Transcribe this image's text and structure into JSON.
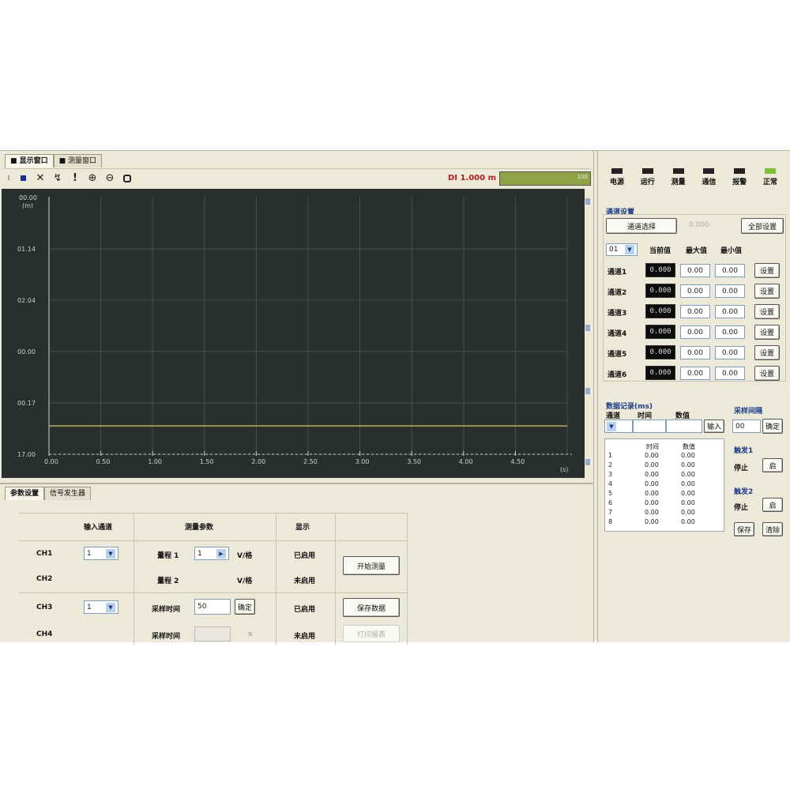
{
  "tabs": [
    "■ 显示窗口",
    "■ 测量窗口"
  ],
  "toolbar": {
    "icons": [
      "stop-square-icon",
      "clear-x-icon",
      "auto-scale-icon",
      "alert-icon",
      "zoom-in-icon",
      "zoom-out-icon",
      "record-icon"
    ],
    "readout": "DI 1.000 m",
    "level_indicator": "100"
  },
  "chart_data": {
    "type": "line",
    "title": "",
    "xlabel": "",
    "ylabel": "(m)",
    "y_top_label": "00.00",
    "y_ticks": [
      "01.14",
      "02.04",
      "00.00",
      "00.17",
      "17.00"
    ],
    "x_ticks": [
      "0.00",
      "0.50",
      "1.00",
      "1.50",
      "2.00",
      "2.50",
      "3.00",
      "3.50",
      "4.00",
      "4.50"
    ],
    "x_end_label": "(s)",
    "series": [
      {
        "values": [
          0.55,
          0.55,
          0.55,
          0.55,
          0.55,
          0.55,
          0.55,
          0.55,
          0.55,
          0.55
        ],
        "color": "#b8b060"
      }
    ],
    "grid": true,
    "background": "#2b2e2e"
  },
  "bottom": {
    "tabs": [
      "参数设置",
      "信号发生器"
    ],
    "col_headers": [
      "输入通道",
      "测量参数",
      "显示"
    ],
    "rows": [
      {
        "label": "CH1",
        "select": "1",
        "param_label": "量程 1",
        "param_value": "1",
        "unit": "V/格",
        "status": "已启用"
      },
      {
        "label": "CH2",
        "param_label": "量程 2",
        "unit": "V/格",
        "status": "未启用"
      },
      {
        "label": "CH3",
        "select": "1",
        "param_label": "采样时间",
        "param_value": "50",
        "apply": "确定",
        "status": "已启用"
      },
      {
        "label": "CH4",
        "param_label": "采样时间",
        "unit": "s",
        "status": "未启用"
      }
    ],
    "buttons": [
      "开始测量",
      "保存数据",
      "打印报表"
    ]
  },
  "right": {
    "leds": [
      {
        "label": "电源",
        "on": false
      },
      {
        "label": "运行",
        "on": false
      },
      {
        "label": "测量",
        "on": false
      },
      {
        "label": "通信",
        "on": false
      },
      {
        "label": "报警",
        "on": false
      },
      {
        "label": "正常",
        "on": true
      }
    ],
    "section1_title": "通道设置",
    "select_button": "通道选择",
    "value_text": "0.000",
    "apply_all_button": "全部设置",
    "channel_select": "01",
    "col_headers": [
      "当前值",
      "最大值",
      "最小值"
    ],
    "rows": [
      {
        "label": "通道1",
        "lcd": "0.000",
        "max": "0.00",
        "min": "0.00",
        "btn": "设置"
      },
      {
        "label": "通道2",
        "lcd": "0.000",
        "max": "0.00",
        "min": "0.00",
        "btn": "设置"
      },
      {
        "label": "通道3",
        "lcd": "0.000",
        "max": "0.00",
        "min": "0.00",
        "btn": "设置"
      },
      {
        "label": "通道4",
        "lcd": "0.000",
        "max": "0.00",
        "min": "0.00",
        "btn": "设置"
      },
      {
        "label": "通道5",
        "lcd": "0.000",
        "max": "0.00",
        "min": "0.00",
        "btn": "设置"
      },
      {
        "label": "通道6",
        "lcd": "0.000",
        "max": "0.00",
        "min": "0.00",
        "btn": "设置"
      }
    ],
    "section2_title": "数据记录(ms)",
    "section2_labels": [
      "通道",
      "时间",
      "数值"
    ],
    "enter_button": "输入",
    "section3_title": "采样间隔",
    "interval_value": "00",
    "interval_button": "确定",
    "list_headers": [
      "时间",
      "数值"
    ],
    "list_rows": [
      [
        "1",
        "0.00",
        "0.00"
      ],
      [
        "2",
        "0.00",
        "0.00"
      ],
      [
        "3",
        "0.00",
        "0.00"
      ],
      [
        "4",
        "0.00",
        "0.00"
      ],
      [
        "5",
        "0.00",
        "0.00"
      ],
      [
        "6",
        "0.00",
        "0.00"
      ],
      [
        "7",
        "0.00",
        "0.00"
      ],
      [
        "8",
        "0.00",
        "0.00"
      ]
    ],
    "trigger1_title": "触发1",
    "trigger1_state": "停止",
    "trigger1_btn": "启",
    "trigger2_title": "触发2",
    "trigger2_state": "停止",
    "trigger2_btn": "启",
    "bottom_buttons": [
      "保存",
      "清除"
    ]
  }
}
